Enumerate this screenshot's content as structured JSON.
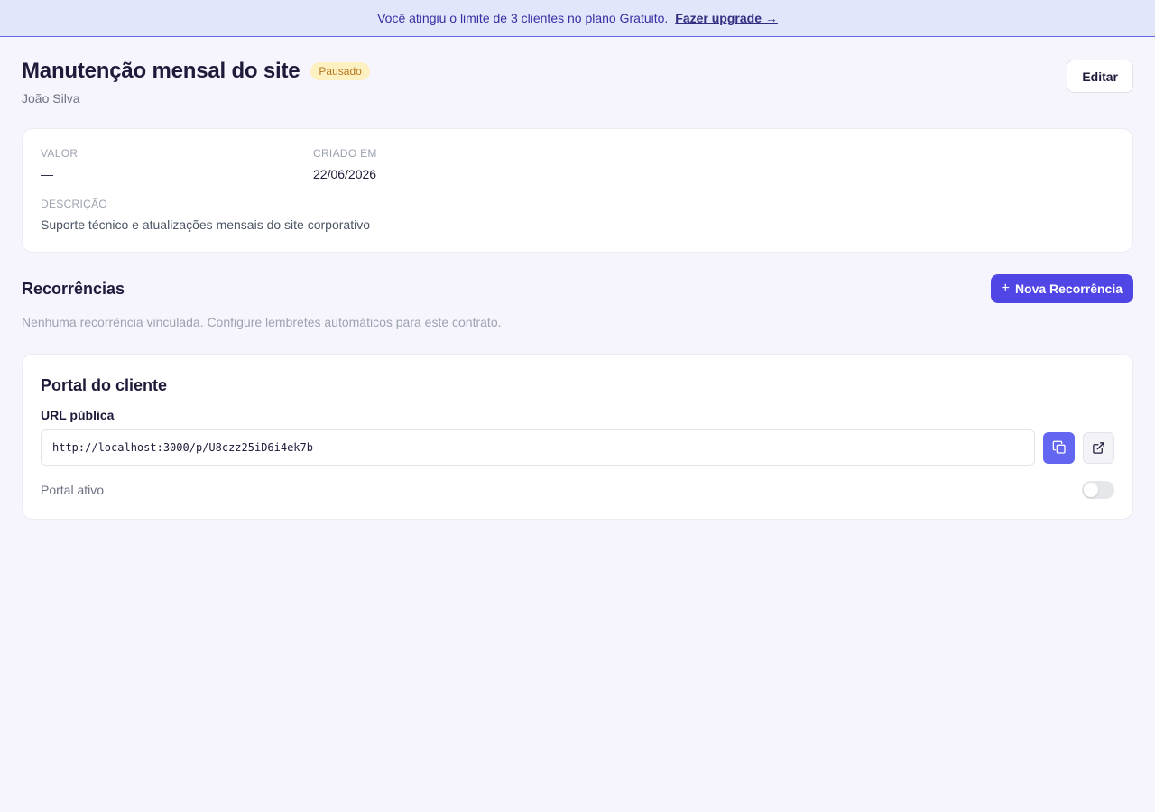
{
  "banner": {
    "message": "Você atingiu o limite de 3 clientes no plano Gratuito.",
    "link_label": "Fazer upgrade →"
  },
  "header": {
    "title": "Manutenção mensal do site",
    "status_badge": "Pausado",
    "client_name": "João Silva",
    "edit_label": "Editar"
  },
  "details": {
    "value_label": "VALOR",
    "value": "—",
    "created_label": "CRIADO EM",
    "created_value": "22/06/2026",
    "description_label": "DESCRIÇÃO",
    "description_value": "Suporte técnico e atualizações mensais do site corporativo"
  },
  "recurrences": {
    "title": "Recorrências",
    "new_button_label": "Nova Recorrência",
    "empty_text": "Nenhuma recorrência vinculada. Configure lembretes automáticos para este contrato."
  },
  "portal": {
    "title": "Portal do cliente",
    "url_label": "URL pública",
    "url_value": "http://localhost:3000/p/U8czz25iD6i4ek7b",
    "copy_icon": "copy-icon",
    "open_icon": "external-link-icon",
    "active_label": "Portal ativo",
    "active": false
  },
  "colors": {
    "accent": "#4f46e5",
    "badge_bg": "#fdf1c2",
    "badge_text": "#b7791f",
    "banner_bg": "#e2e6fb"
  }
}
